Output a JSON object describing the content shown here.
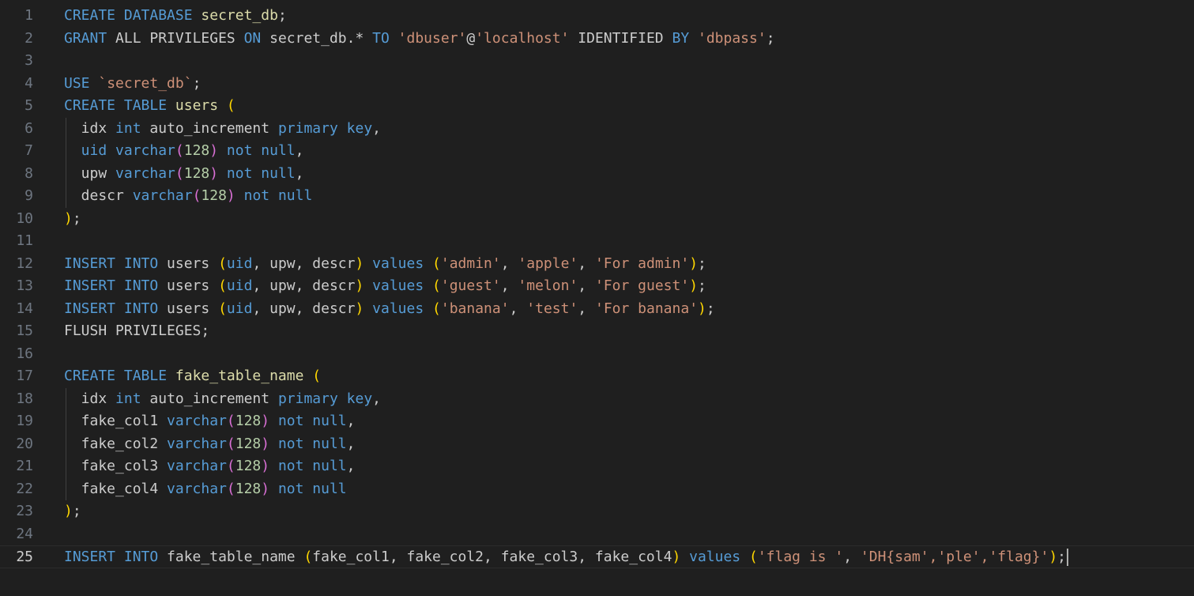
{
  "editor": {
    "language": "sql",
    "current_line": 25,
    "colors": {
      "background": "#1f1f1f",
      "line_number": "#6e7681",
      "line_number_active": "#cccccc",
      "keyword": "#569cd6",
      "identifier": "#dcdcaa",
      "plain": "#cccccc",
      "string": "#ce9178",
      "number": "#b5cea8",
      "bracket_level1": "#ffd700",
      "bracket_level2": "#da70d6"
    },
    "lines": [
      {
        "n": "1",
        "tokens": [
          [
            "kw",
            "CREATE DATABASE "
          ],
          [
            "id",
            "secret_db"
          ],
          [
            "pl",
            ";"
          ]
        ]
      },
      {
        "n": "2",
        "tokens": [
          [
            "kw",
            "GRANT "
          ],
          [
            "pl",
            "ALL PRIVILEGES "
          ],
          [
            "kw",
            "ON "
          ],
          [
            "pl",
            "secret_db.* "
          ],
          [
            "kw",
            "TO "
          ],
          [
            "st",
            "'dbuser'"
          ],
          [
            "pl",
            "@"
          ],
          [
            "st",
            "'localhost' "
          ],
          [
            "pl",
            "IDENTIFIED "
          ],
          [
            "kw",
            "BY "
          ],
          [
            "st",
            "'dbpass'"
          ],
          [
            "pl",
            ";"
          ]
        ]
      },
      {
        "n": "3",
        "tokens": []
      },
      {
        "n": "4",
        "tokens": [
          [
            "kw",
            "USE "
          ],
          [
            "st",
            "`secret_db`"
          ],
          [
            "pl",
            ";"
          ]
        ]
      },
      {
        "n": "5",
        "tokens": [
          [
            "kw",
            "CREATE TABLE "
          ],
          [
            "id",
            "users "
          ],
          [
            "b1",
            "("
          ]
        ]
      },
      {
        "n": "6",
        "tokens": [
          [
            "pl",
            "  idx "
          ],
          [
            "kw",
            "int "
          ],
          [
            "pl",
            "auto_increment "
          ],
          [
            "kw",
            "primary key"
          ],
          [
            "pl",
            ","
          ]
        ]
      },
      {
        "n": "7",
        "tokens": [
          [
            "kw",
            "  uid varchar"
          ],
          [
            "b2",
            "("
          ],
          [
            "nm",
            "128"
          ],
          [
            "b2",
            ")"
          ],
          [
            "kw",
            " not null"
          ],
          [
            "pl",
            ","
          ]
        ]
      },
      {
        "n": "8",
        "tokens": [
          [
            "pl",
            "  upw "
          ],
          [
            "kw",
            "varchar"
          ],
          [
            "b2",
            "("
          ],
          [
            "nm",
            "128"
          ],
          [
            "b2",
            ")"
          ],
          [
            "kw",
            " not null"
          ],
          [
            "pl",
            ","
          ]
        ]
      },
      {
        "n": "9",
        "tokens": [
          [
            "pl",
            "  descr "
          ],
          [
            "kw",
            "varchar"
          ],
          [
            "b2",
            "("
          ],
          [
            "nm",
            "128"
          ],
          [
            "b2",
            ")"
          ],
          [
            "kw",
            " not null"
          ]
        ]
      },
      {
        "n": "10",
        "tokens": [
          [
            "b1",
            ")"
          ],
          [
            "pl",
            ";"
          ]
        ]
      },
      {
        "n": "11",
        "tokens": []
      },
      {
        "n": "12",
        "tokens": [
          [
            "kw",
            "INSERT INTO "
          ],
          [
            "pl",
            "users "
          ],
          [
            "b1",
            "("
          ],
          [
            "kw",
            "uid"
          ],
          [
            "pl",
            ", upw, descr"
          ],
          [
            "b1",
            ")"
          ],
          [
            "kw",
            " values "
          ],
          [
            "b1",
            "("
          ],
          [
            "st",
            "'admin'"
          ],
          [
            "pl",
            ", "
          ],
          [
            "st",
            "'apple'"
          ],
          [
            "pl",
            ", "
          ],
          [
            "st",
            "'For admin'"
          ],
          [
            "b1",
            ")"
          ],
          [
            "pl",
            ";"
          ]
        ]
      },
      {
        "n": "13",
        "tokens": [
          [
            "kw",
            "INSERT INTO "
          ],
          [
            "pl",
            "users "
          ],
          [
            "b1",
            "("
          ],
          [
            "kw",
            "uid"
          ],
          [
            "pl",
            ", upw, descr"
          ],
          [
            "b1",
            ")"
          ],
          [
            "kw",
            " values "
          ],
          [
            "b1",
            "("
          ],
          [
            "st",
            "'guest'"
          ],
          [
            "pl",
            ", "
          ],
          [
            "st",
            "'melon'"
          ],
          [
            "pl",
            ", "
          ],
          [
            "st",
            "'For guest'"
          ],
          [
            "b1",
            ")"
          ],
          [
            "pl",
            ";"
          ]
        ]
      },
      {
        "n": "14",
        "tokens": [
          [
            "kw",
            "INSERT INTO "
          ],
          [
            "pl",
            "users "
          ],
          [
            "b1",
            "("
          ],
          [
            "kw",
            "uid"
          ],
          [
            "pl",
            ", upw, descr"
          ],
          [
            "b1",
            ")"
          ],
          [
            "kw",
            " values "
          ],
          [
            "b1",
            "("
          ],
          [
            "st",
            "'banana'"
          ],
          [
            "pl",
            ", "
          ],
          [
            "st",
            "'test'"
          ],
          [
            "pl",
            ", "
          ],
          [
            "st",
            "'For banana'"
          ],
          [
            "b1",
            ")"
          ],
          [
            "pl",
            ";"
          ]
        ]
      },
      {
        "n": "15",
        "tokens": [
          [
            "pl",
            "FLUSH PRIVILEGES;"
          ]
        ]
      },
      {
        "n": "16",
        "tokens": []
      },
      {
        "n": "17",
        "tokens": [
          [
            "kw",
            "CREATE TABLE "
          ],
          [
            "id",
            "fake_table_name "
          ],
          [
            "b1",
            "("
          ]
        ]
      },
      {
        "n": "18",
        "tokens": [
          [
            "pl",
            "  idx "
          ],
          [
            "kw",
            "int "
          ],
          [
            "pl",
            "auto_increment "
          ],
          [
            "kw",
            "primary key"
          ],
          [
            "pl",
            ","
          ]
        ]
      },
      {
        "n": "19",
        "tokens": [
          [
            "pl",
            "  fake_col1 "
          ],
          [
            "kw",
            "varchar"
          ],
          [
            "b2",
            "("
          ],
          [
            "nm",
            "128"
          ],
          [
            "b2",
            ")"
          ],
          [
            "kw",
            " not null"
          ],
          [
            "pl",
            ","
          ]
        ]
      },
      {
        "n": "20",
        "tokens": [
          [
            "pl",
            "  fake_col2 "
          ],
          [
            "kw",
            "varchar"
          ],
          [
            "b2",
            "("
          ],
          [
            "nm",
            "128"
          ],
          [
            "b2",
            ")"
          ],
          [
            "kw",
            " not null"
          ],
          [
            "pl",
            ","
          ]
        ]
      },
      {
        "n": "21",
        "tokens": [
          [
            "pl",
            "  fake_col3 "
          ],
          [
            "kw",
            "varchar"
          ],
          [
            "b2",
            "("
          ],
          [
            "nm",
            "128"
          ],
          [
            "b2",
            ")"
          ],
          [
            "kw",
            " not null"
          ],
          [
            "pl",
            ","
          ]
        ]
      },
      {
        "n": "22",
        "tokens": [
          [
            "pl",
            "  fake_col4 "
          ],
          [
            "kw",
            "varchar"
          ],
          [
            "b2",
            "("
          ],
          [
            "nm",
            "128"
          ],
          [
            "b2",
            ")"
          ],
          [
            "kw",
            " not null"
          ]
        ]
      },
      {
        "n": "23",
        "tokens": [
          [
            "b1",
            ")"
          ],
          [
            "pl",
            ";"
          ]
        ]
      },
      {
        "n": "24",
        "tokens": []
      },
      {
        "n": "25",
        "tokens": [
          [
            "kw",
            "INSERT INTO "
          ],
          [
            "pl",
            "fake_table_name "
          ],
          [
            "b1",
            "("
          ],
          [
            "pl",
            "fake_col1, fake_col2, fake_col3, fake_col4"
          ],
          [
            "b1",
            ")"
          ],
          [
            "kw",
            " values "
          ],
          [
            "b1",
            "("
          ],
          [
            "st",
            "'flag is '"
          ],
          [
            "pl",
            ", "
          ],
          [
            "st",
            "'DH{sam','ple','flag}'"
          ],
          [
            "b1",
            ")"
          ],
          [
            "pl",
            ";"
          ]
        ]
      }
    ]
  }
}
